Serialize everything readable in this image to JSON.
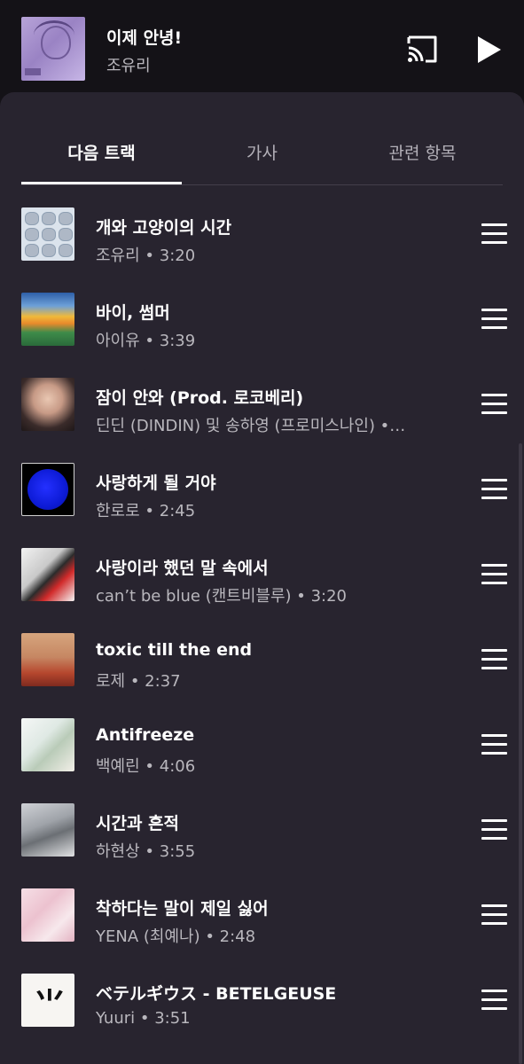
{
  "mini_player": {
    "title": "이제 안녕!",
    "artist": "조유리",
    "cast_icon": "cast-icon",
    "play_icon": "play-icon"
  },
  "tabs": [
    {
      "label": "다음 트랙",
      "active": true
    },
    {
      "label": "가사",
      "active": false
    },
    {
      "label": "관련 항목",
      "active": false
    }
  ],
  "tracks": [
    {
      "title": "개와 고양이의 시간",
      "subtitle": "조유리 • 3:20"
    },
    {
      "title": "바이, 썸머",
      "subtitle": "아이유 • 3:39"
    },
    {
      "title": "잠이 안와 (Prod. 로코베리)",
      "subtitle": "딘딘 (DINDIN) 및 송하영 (프로미스나인) •…"
    },
    {
      "title": "사랑하게 될 거야",
      "subtitle": "한로로 • 2:45"
    },
    {
      "title": "사랑이라 했던 말 속에서",
      "subtitle": "can’t be blue (캔트비블루) • 3:20"
    },
    {
      "title": "toxic till the end",
      "subtitle": "로제 • 2:37"
    },
    {
      "title": "Antifreeze",
      "subtitle": "백예린 • 4:06"
    },
    {
      "title": "시간과 흔적",
      "subtitle": "하현상 • 3:55"
    },
    {
      "title": "착하다는 말이 제일 싫어",
      "subtitle": "YENA (최예나) • 2:48"
    },
    {
      "title": "ベテルギウス - BETELGEUSE",
      "subtitle": "Yuuri • 3:51"
    }
  ],
  "colors": {
    "background": "#141217",
    "panel": "#28242f",
    "text_primary": "#ffffff",
    "text_secondary": "#b9b7bd"
  }
}
